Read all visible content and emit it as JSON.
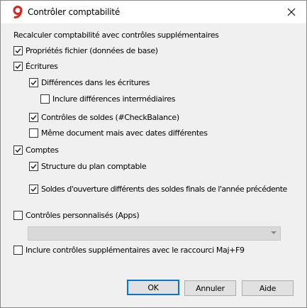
{
  "window": {
    "title": "Contrôler comptabilité",
    "icon_color": "#d9251d"
  },
  "section_title": "Recalculer comptabilité avec contrôles supplémentaires",
  "checkboxes": {
    "file_props": {
      "label": "Propriétés fichier (données de base)",
      "checked": true
    },
    "entries": {
      "label": "Écritures",
      "checked": true
    },
    "entry_diffs": {
      "label": "Différences dans les  écritures",
      "checked": true
    },
    "intermediate_diffs": {
      "label": "Inclure différences intermédiaires",
      "checked": false
    },
    "balance_checks": {
      "label": "Contrôles de soldes (#CheckBalance)",
      "checked": true
    },
    "same_doc": {
      "label": "Même document mais avec dates différentes",
      "checked": false
    },
    "accounts": {
      "label": "Comptes",
      "checked": true
    },
    "chart_structure": {
      "label": "Structure du plan comptable",
      "checked": true
    },
    "opening_balances": {
      "label": "Soldes d'ouverture différents des soldes finals de l'année précédente",
      "checked": true
    },
    "custom_checks": {
      "label": "Contrôles personnalisés (Apps)",
      "checked": false
    },
    "include_shortcut": {
      "label": "Inclure contrôles supplémentaires avec le raccourci Maj+F9",
      "checked": false
    }
  },
  "custom_select": {
    "value": ""
  },
  "buttons": {
    "ok": "OK",
    "cancel": "Annuler",
    "help": "Aide"
  },
  "colors": {
    "accent": "#0078d7",
    "background": "#f0f0f0"
  }
}
